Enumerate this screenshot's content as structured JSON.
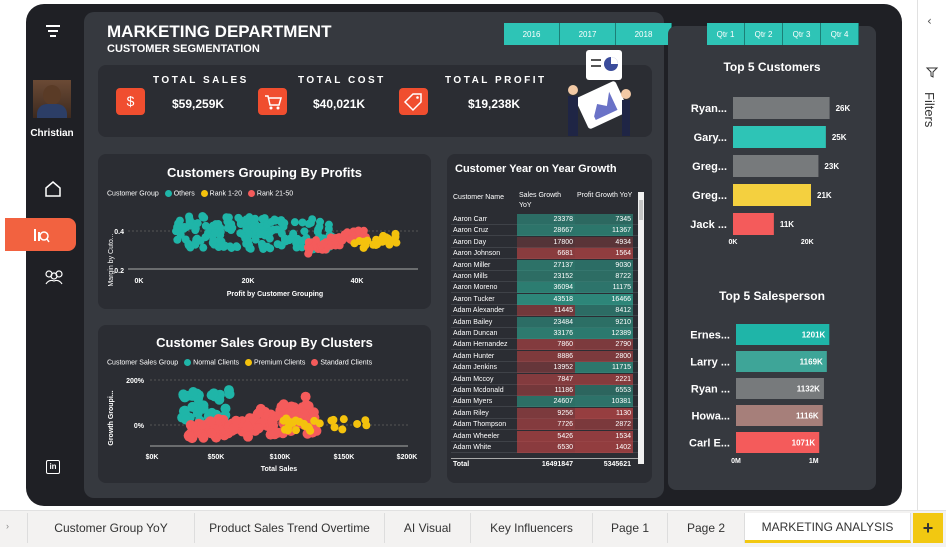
{
  "header": {
    "title": "MARKETING DEPARTMENT",
    "subtitle": "CUSTOMER SEGMENTATION"
  },
  "years": [
    "2016",
    "2017",
    "2018"
  ],
  "quarters": [
    "Qtr 1",
    "Qtr 2",
    "Qtr 3",
    "Qtr 4"
  ],
  "user": {
    "name": "Christian"
  },
  "kpis": [
    {
      "label": "TOTAL SALES",
      "value": "$59,259K",
      "icon": "dollar-icon"
    },
    {
      "label": "TOTAL COST",
      "value": "$40,021K",
      "icon": "cart-icon"
    },
    {
      "label": "TOTAL PROFIT",
      "value": "$19,238K",
      "icon": "tag-icon"
    }
  ],
  "colors": {
    "teal": "#1fb5a8",
    "yellow": "#f4c20d",
    "red": "#f45b5b",
    "gray": "#777a7c"
  },
  "profit_chart": {
    "title": "Customers Grouping By Profits",
    "legend_label": "Customer Group",
    "legend": [
      "Others",
      "Rank 1-20",
      "Rank 21-50"
    ],
    "ylabel": "Margin by Cuto...",
    "xlabel": "Profit by Customer Grouping",
    "xticks": [
      "0K",
      "20K",
      "40K"
    ],
    "yticks": [
      "0.4",
      "0.2"
    ]
  },
  "cluster_chart": {
    "title": "Customer Sales Group By Clusters",
    "legend_label": "Customer Sales Group",
    "legend": [
      "Normal Clients",
      "Premium Clients",
      "Standard Clients"
    ],
    "ylabel": "Growth Groupi...",
    "xlabel": "Total Sales",
    "xticks": [
      "$0K",
      "$50K",
      "$100K",
      "$150K",
      "$200K"
    ],
    "yticks": [
      "200%",
      "0%"
    ]
  },
  "growth_table": {
    "title": "Customer Year on Year Growth",
    "headers": [
      "Customer Name",
      "Sales Growth YoY",
      "Profit Growth YoY"
    ],
    "rows": [
      [
        "Aaron Carr",
        "23378",
        "7345"
      ],
      [
        "Aaron Cruz",
        "28667",
        "11367"
      ],
      [
        "Aaron Day",
        "17800",
        "4934"
      ],
      [
        "Aaron Johnson",
        "6681",
        "1564"
      ],
      [
        "Aaron Miller",
        "27137",
        "9030"
      ],
      [
        "Aaron Mills",
        "23152",
        "8722"
      ],
      [
        "Aaron Moreno",
        "36094",
        "11175"
      ],
      [
        "Aaron Tucker",
        "43518",
        "16466"
      ],
      [
        "Adam Alexander",
        "11445",
        "8412"
      ],
      [
        "Adam Bailey",
        "23484",
        "9210"
      ],
      [
        "Adam Duncan",
        "33176",
        "12389"
      ],
      [
        "Adam Hernandez",
        "7860",
        "2790"
      ],
      [
        "Adam Hunter",
        "8886",
        "2800"
      ],
      [
        "Adam Jenkins",
        "13952",
        "11715"
      ],
      [
        "Adam Mccoy",
        "7847",
        "2221"
      ],
      [
        "Adam Mcdonald",
        "11186",
        "6553"
      ],
      [
        "Adam Myers",
        "24607",
        "10381"
      ],
      [
        "Adam Riley",
        "9256",
        "1130"
      ],
      [
        "Adam Thompson",
        "7726",
        "2872"
      ],
      [
        "Adam Wheeler",
        "5426",
        "1534"
      ],
      [
        "Adam White",
        "6530",
        "1402"
      ]
    ],
    "total_label": "Total",
    "total_sales": "16491847",
    "total_profit": "5345621"
  },
  "chart_data": [
    {
      "type": "bar",
      "title": "Top 5 Customers",
      "categories": [
        "Ryan...",
        "Gary...",
        "Greg...",
        "Greg...",
        "Jack ..."
      ],
      "values": [
        26,
        25,
        23,
        21,
        11
      ],
      "labels": [
        "26K",
        "25K",
        "23K",
        "21K",
        "11K"
      ],
      "xticks": [
        "0K",
        "20K"
      ],
      "xlim": [
        0,
        28
      ],
      "colors": [
        "#777a7c",
        "#2ec4b6",
        "#777a7c",
        "#f4d03f",
        "#f45b5b"
      ]
    },
    {
      "type": "bar",
      "title": "Top 5 Salesperson",
      "categories": [
        "Ernes...",
        "Larry ...",
        "Ryan ...",
        "Howa...",
        "Carl E..."
      ],
      "values": [
        1.201,
        1.169,
        1.132,
        1.116,
        1.071
      ],
      "labels": [
        "1201K",
        "1169K",
        "1132K",
        "1116K",
        "1071K"
      ],
      "xticks": [
        "0M",
        "1M"
      ],
      "xlim": [
        0,
        1.3
      ],
      "colors": [
        "#1fb5a8",
        "#3ea598",
        "#777a7c",
        "#a67f7a",
        "#f45b5b"
      ]
    }
  ],
  "filters_label": "Filters",
  "tabs": [
    "Customer Group YoY",
    "Product Sales Trend Overtime",
    "AI Visual",
    "Key Influencers",
    "Page 1",
    "Page 2",
    "MARKETING ANALYSIS"
  ],
  "add_tab": "+"
}
